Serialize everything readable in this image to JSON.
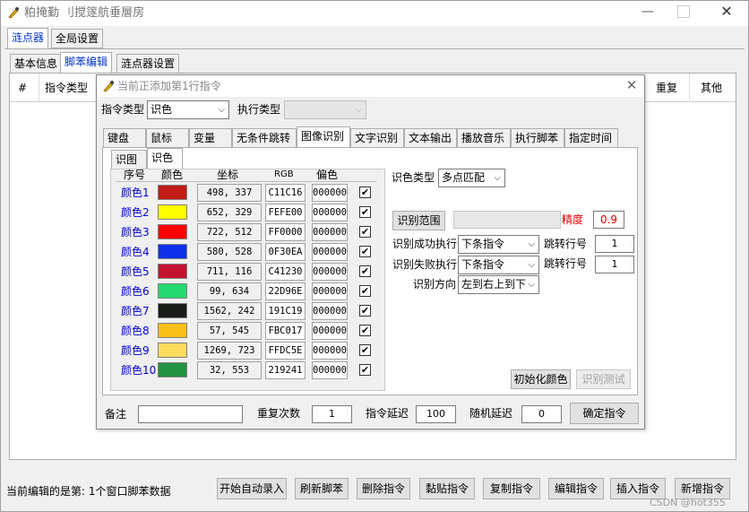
{
  "app": {
    "title": "粕掩勤 刂搅篴航垂層房",
    "tabs": [
      "涟点器",
      "全局设置"
    ],
    "subtabs": [
      "基本信息",
      "脚苯编辑",
      "涟点器设置"
    ]
  },
  "grid": {
    "headers": [
      "#",
      "指令类型"
    ],
    "right_headers": [
      "重复",
      "其他"
    ]
  },
  "dialog": {
    "title": "当前正添加第1行指令",
    "cmd_type_label": "指令类型",
    "cmd_type_value": "识色",
    "exec_type_label": "执行类型",
    "exec_type_value": "",
    "tabs": [
      "键盘",
      "鼠标",
      "变量",
      "无条件跳转",
      "图像识别",
      "文字识别",
      "文本输出",
      "播放音乐",
      "执行脚苯",
      "指定时间"
    ],
    "inner_tabs": [
      "识图",
      "识色"
    ],
    "table_headers": [
      "序号",
      "颜色",
      "坐标",
      "RGB",
      "偏色"
    ],
    "rows": [
      {
        "name": "颜色1",
        "color": "#C11C16",
        "coord": "498, 337",
        "rgb": "C11C16",
        "offset": "000000",
        "checked": "✔"
      },
      {
        "name": "颜色2",
        "color": "#FEFE00",
        "coord": "652, 329",
        "rgb": "FEFE00",
        "offset": "000000",
        "checked": "✔"
      },
      {
        "name": "颜色3",
        "color": "#FF0000",
        "coord": "722, 512",
        "rgb": "FF0000",
        "offset": "000000",
        "checked": "✔"
      },
      {
        "name": "颜色4",
        "color": "#0F30EA",
        "coord": "580, 528",
        "rgb": "0F30EA",
        "offset": "000000",
        "checked": "✔"
      },
      {
        "name": "颜色5",
        "color": "#C41230",
        "coord": "711, 116",
        "rgb": "C41230",
        "offset": "000000",
        "checked": "✔"
      },
      {
        "name": "颜色6",
        "color": "#22D96E",
        "coord": "99, 634",
        "rgb": "22D96E",
        "offset": "000000",
        "checked": "✔"
      },
      {
        "name": "颜色7",
        "color": "#191C19",
        "coord": "1562, 242",
        "rgb": "191C19",
        "offset": "000000",
        "checked": "✔"
      },
      {
        "name": "颜色8",
        "color": "#FBC017",
        "coord": "57, 545",
        "rgb": "FBC017",
        "offset": "000000",
        "checked": "✔"
      },
      {
        "name": "颜色9",
        "color": "#FFDC5E",
        "coord": "1269, 723",
        "rgb": "FFDC5E",
        "offset": "000000",
        "checked": "✔"
      },
      {
        "name": "颜色10",
        "color": "#219241",
        "coord": "32, 553",
        "rgb": "219241",
        "offset": "000000",
        "checked": "✔"
      }
    ],
    "color_type_label": "识色类型",
    "color_type_value": "多点匹配",
    "range_button": "识别范围",
    "precision_label": "精度",
    "precision_value": "0.9",
    "success_label": "识别成功执行",
    "success_value": "下条指令",
    "success_jump_label": "跳转行号",
    "success_jump_value": "1",
    "fail_label": "识别失败执行",
    "fail_value": "下条指令",
    "fail_jump_label": "跳转行号",
    "fail_jump_value": "1",
    "direction_label": "识别方向",
    "direction_value": "左到右上到下",
    "init_button": "初始化颜色",
    "test_button": "识别测试",
    "note_label": "备注",
    "note_value": "",
    "repeat_label": "重复次数",
    "repeat_value": "1",
    "delay_label": "指令延迟",
    "delay_value": "100",
    "random_label": "随机延迟",
    "random_value": "0",
    "confirm_button": "确定指令"
  },
  "status": {
    "text": "当前编辑的是第: 1个窗口脚苯数据"
  },
  "buttons": [
    "开始自动录入",
    "刷新脚苯",
    "删除指令",
    "黏贴指令",
    "复制指令",
    "编辑指令",
    "插入指令",
    "新增指令"
  ],
  "watermark": "CSDN @hot355"
}
